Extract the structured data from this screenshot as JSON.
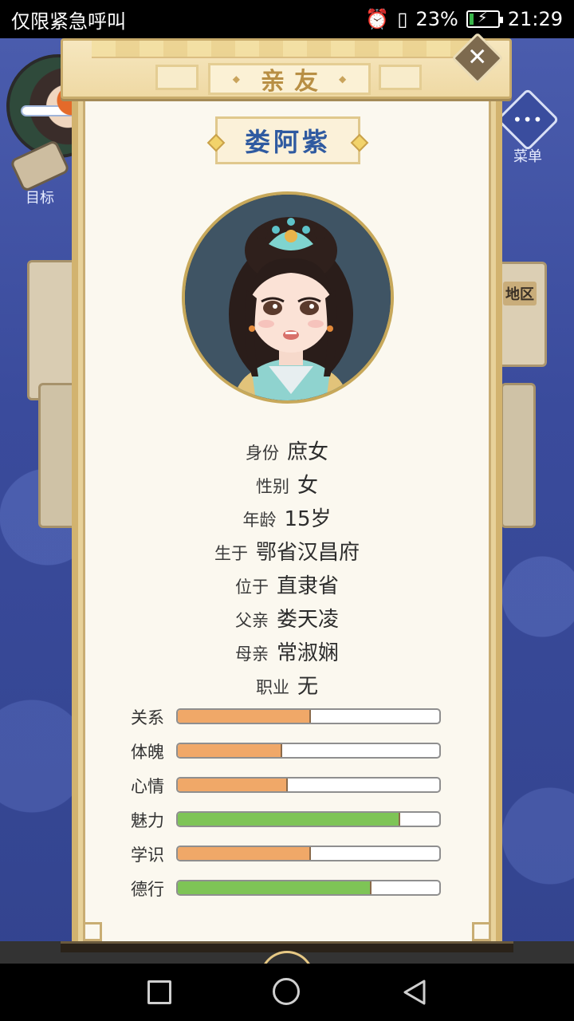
{
  "status_bar": {
    "carrier_text": "仅限紧急呼叫",
    "battery_percent": "23%",
    "battery_level": 0.23,
    "time": "21:29",
    "icons": [
      "alarm-icon",
      "sim-icon",
      "battery-icon"
    ]
  },
  "background": {
    "target_label": "目标",
    "menu_label": "菜单",
    "region_label": "地区"
  },
  "panel": {
    "title": "亲友",
    "close_icon": "close-icon"
  },
  "character": {
    "name": "娄阿紫",
    "info": [
      {
        "label": "身份",
        "value": "庶女"
      },
      {
        "label": "性别",
        "value": "女"
      },
      {
        "label": "年龄",
        "value": "15岁"
      },
      {
        "label": "生于",
        "value": "鄂省汉昌府"
      },
      {
        "label": "位于",
        "value": "直隶省"
      },
      {
        "label": "父亲",
        "value": "娄天凌"
      },
      {
        "label": "母亲",
        "value": "常淑娴"
      },
      {
        "label": "职业",
        "value": "无"
      }
    ],
    "stats": [
      {
        "label": "关系",
        "value": 0.51,
        "color": "#f0a868"
      },
      {
        "label": "体魄",
        "value": 0.4,
        "color": "#f0a868"
      },
      {
        "label": "心情",
        "value": 0.42,
        "color": "#f0a868"
      },
      {
        "label": "魅力",
        "value": 0.85,
        "color": "#7ec456"
      },
      {
        "label": "学识",
        "value": 0.51,
        "color": "#f0a868"
      },
      {
        "label": "德行",
        "value": 0.74,
        "color": "#7ec456"
      }
    ]
  },
  "nav_bar": {
    "icons": [
      "recents-square-icon",
      "home-circle-icon",
      "back-triangle-icon"
    ]
  }
}
